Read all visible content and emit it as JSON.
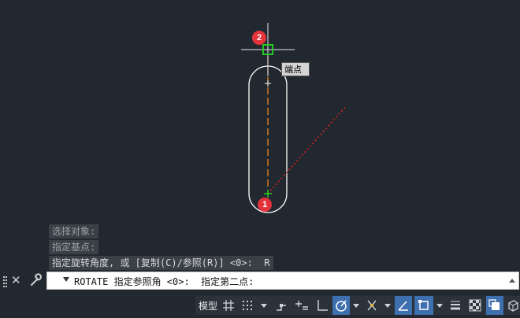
{
  "tooltip": "端点",
  "badges": {
    "first": "1",
    "second": "2"
  },
  "history": [
    "选择对象:",
    "指定基点:",
    "指定旋转角度, 或 [复制(C)/参照(R)] <0>:  R"
  ],
  "command": {
    "text": "ROTATE 指定参照角 <0>:  指定第二点:"
  },
  "statusbar": {
    "model_label": "模型"
  },
  "colors": {
    "background": "#212830",
    "shape_outline": "#ffffff",
    "axis_dash": "#ff8c1a",
    "rubberband": "#e02020",
    "snap_marker": "#22cc22",
    "badge": "#e5333b",
    "active_toggle": "#3e6fae"
  },
  "icons": [
    "close-icon",
    "wrench-icon",
    "grid-icon",
    "snap-icon",
    "infer-constraints-icon",
    "dynamic-input-icon",
    "ortho-icon",
    "polar-tracking-icon",
    "object-snap-tracking-icon",
    "object-snap-icon",
    "lineweight-icon",
    "transparency-icon",
    "selection-cycling-icon",
    "3d-osnap-icon"
  ]
}
